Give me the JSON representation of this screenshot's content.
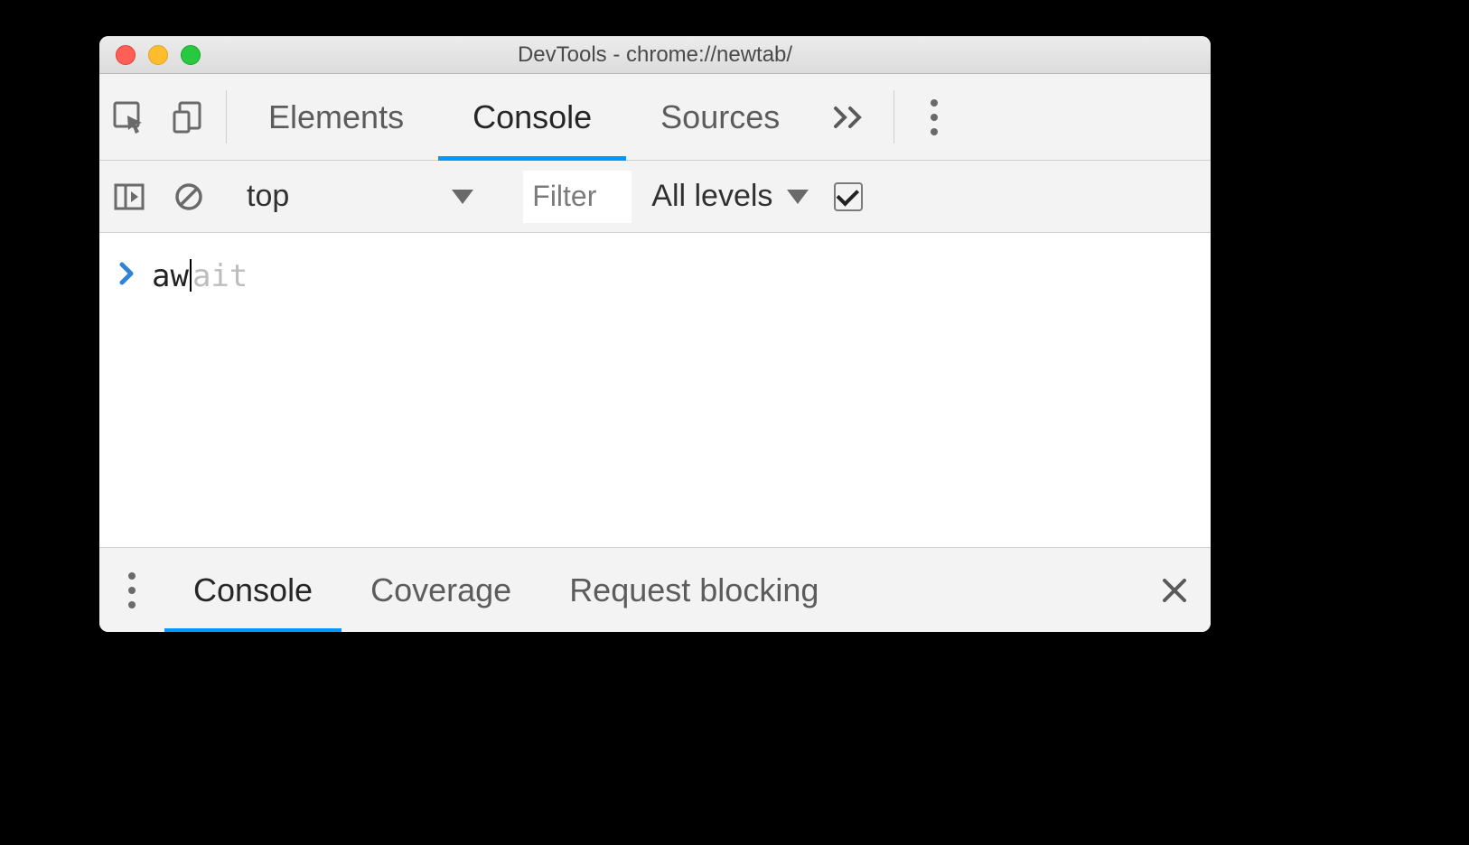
{
  "window": {
    "title": "DevTools - chrome://newtab/"
  },
  "tabs": {
    "elements": "Elements",
    "console": "Console",
    "sources": "Sources"
  },
  "console_toolbar": {
    "context": "top",
    "filter_placeholder": "Filter",
    "levels_label": "All levels"
  },
  "console_input": {
    "typed": "aw",
    "autocomplete_suffix": "ait"
  },
  "drawer": {
    "console": "Console",
    "coverage": "Coverage",
    "request_blocking": "Request blocking"
  }
}
